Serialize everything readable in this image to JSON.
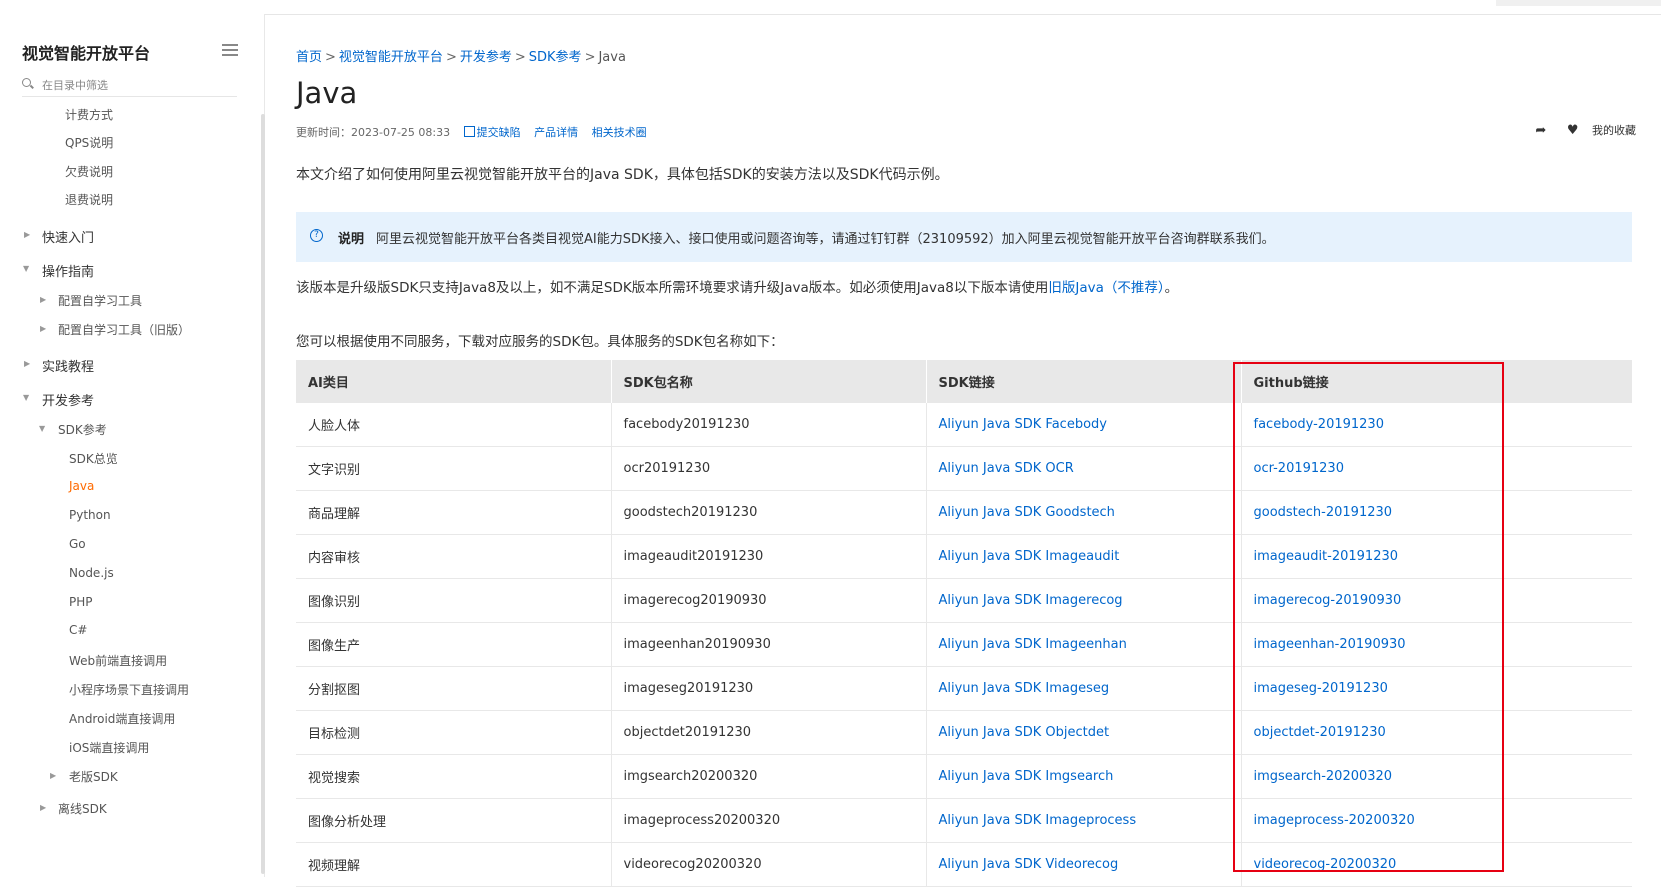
{
  "sidebar": {
    "title": "视觉智能开放平台",
    "filter_placeholder": "在目录中筛选",
    "items": [
      {
        "label": "计费方式"
      },
      {
        "label": "QPS说明"
      },
      {
        "label": "欠费说明"
      },
      {
        "label": "退费说明"
      },
      {
        "label": "快速入门"
      },
      {
        "label": "操作指南"
      },
      {
        "label": "配置自学习工具"
      },
      {
        "label": "配置自学习工具（旧版）"
      },
      {
        "label": "实践教程"
      },
      {
        "label": "开发参考"
      },
      {
        "label": "SDK参考"
      },
      {
        "label": "SDK总览"
      },
      {
        "label": "Java"
      },
      {
        "label": "Python"
      },
      {
        "label": "Go"
      },
      {
        "label": "Node.js"
      },
      {
        "label": "PHP"
      },
      {
        "label": "C#"
      },
      {
        "label": "Web前端直接调用"
      },
      {
        "label": "小程序场景下直接调用"
      },
      {
        "label": "Android端直接调用"
      },
      {
        "label": "iOS端直接调用"
      },
      {
        "label": "老版SDK"
      },
      {
        "label": "离线SDK"
      }
    ]
  },
  "breadcrumb": {
    "home": "首页",
    "platform": "视觉智能开放平台",
    "dev_ref": "开发参考",
    "sdk_ref": "SDK参考",
    "current": "Java",
    "separator": ">"
  },
  "page": {
    "title": "Java",
    "updated": "更新时间：2023-07-25 08:33",
    "submit_bug": "提交缺陷",
    "product_detail": "产品详情",
    "related_tech": "相关技术圈",
    "favorites": "我的收藏",
    "intro": "本文介绍了如何使用阿里云视觉智能开放平台的Java SDK，具体包括SDK的安装方法以及SDK代码示例。",
    "note_label": "说明",
    "note_text": "阿里云视觉智能开放平台各类目视觉AI能力SDK接入、接口使用或问题咨询等，请通过钉钉群（23109592）加入阿里云视觉智能开放平台咨询群联系我们。",
    "para2_pre": "该版本是升级版SDK只支持Java8及以上，如不满足SDK版本所需环境要求请升级Java版本。如必须使用Java8以下版本请使用",
    "para2_link": "旧版Java（不推荐）",
    "para2_post": "。",
    "para3": "您可以根据使用不同服务，下载对应服务的SDK包。具体服务的SDK包名称如下："
  },
  "table": {
    "headers": [
      "AI类目",
      "SDK包名称",
      "SDK链接",
      "Github链接"
    ],
    "rows": [
      [
        "人脸人体",
        "facebody20191230",
        "Aliyun Java SDK Facebody",
        "facebody-20191230"
      ],
      [
        "文字识别",
        "ocr20191230",
        "Aliyun Java SDK OCR",
        "ocr-20191230"
      ],
      [
        "商品理解",
        "goodstech20191230",
        "Aliyun Java SDK Goodstech",
        "goodstech-20191230"
      ],
      [
        "内容审核",
        "imageaudit20191230",
        "Aliyun Java SDK Imageaudit",
        "imageaudit-20191230"
      ],
      [
        "图像识别",
        "imagerecog20190930",
        "Aliyun Java SDK Imagerecog",
        "imagerecog-20190930"
      ],
      [
        "图像生产",
        "imageenhan20190930",
        "Aliyun Java SDK Imageenhan",
        "imageenhan-20190930"
      ],
      [
        "分割抠图",
        "imageseg20191230",
        "Aliyun Java SDK Imageseg",
        "imageseg-20191230"
      ],
      [
        "目标检测",
        "objectdet20191230",
        "Aliyun Java SDK Objectdet",
        "objectdet-20191230"
      ],
      [
        "视觉搜索",
        "imgsearch20200320",
        "Aliyun Java SDK Imgsearch",
        "imgsearch-20200320"
      ],
      [
        "图像分析处理",
        "imageprocess20200320",
        "Aliyun Java SDK Imageprocess",
        "imageprocess-20200320"
      ],
      [
        "视频理解",
        "videorecog20200320",
        "Aliyun Java SDK Videorecog",
        "videorecog-20200320"
      ]
    ]
  },
  "colors": {
    "link": "#0066cc",
    "active": "#ff6a00",
    "highlight_box": "#e60012",
    "note_bg": "#e6f2fd"
  }
}
